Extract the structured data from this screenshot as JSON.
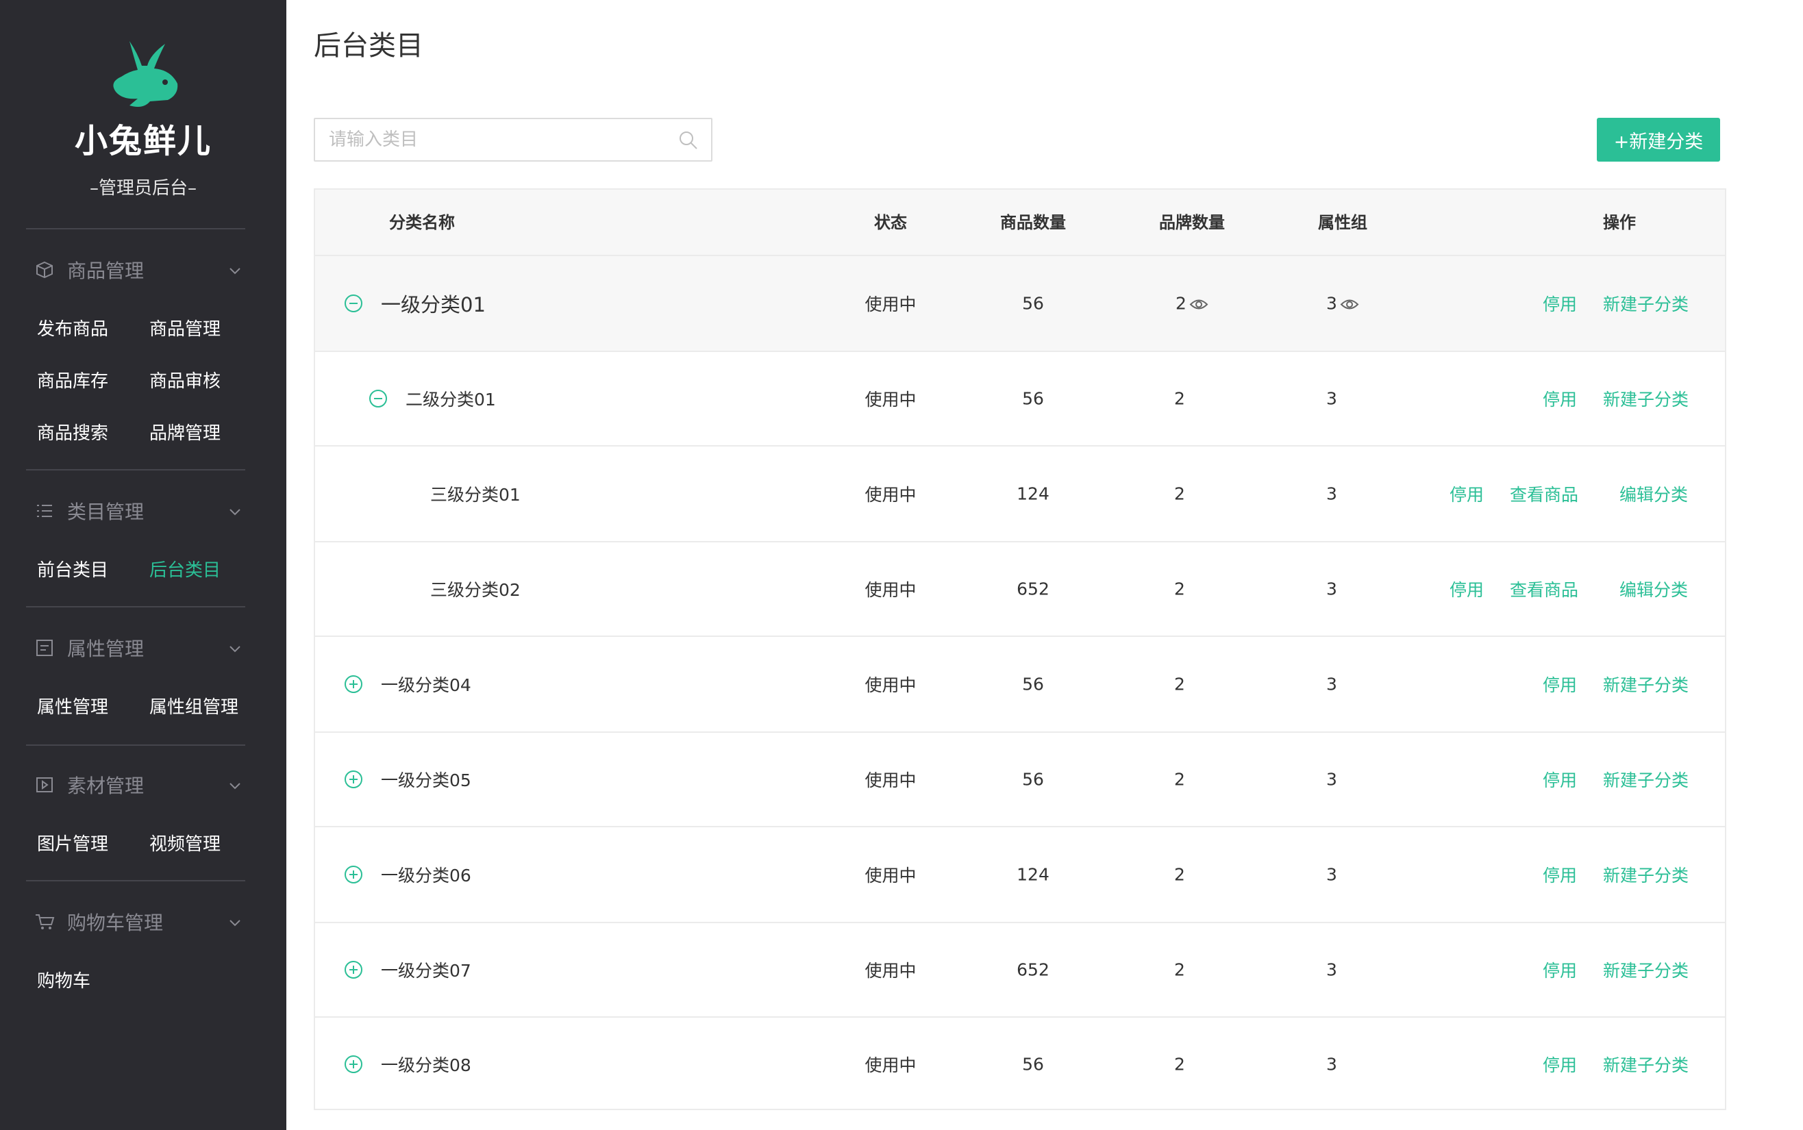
{
  "brand": {
    "name": "小兔鲜儿",
    "subtitle": "–管理员后台–",
    "accent_color": "#2bbf96",
    "sidebar_bg": "#2b2b30"
  },
  "sidebar": {
    "groups": [
      {
        "label": "商品管理",
        "icon": "box-icon",
        "items": [
          "发布商品",
          "商品管理",
          "商品库存",
          "商品审核",
          "商品搜索",
          "品牌管理"
        ]
      },
      {
        "label": "类目管理",
        "icon": "list-icon",
        "items": [
          "前台类目",
          "后台类目"
        ],
        "active": "后台类目"
      },
      {
        "label": "属性管理",
        "icon": "attribute-icon",
        "items": [
          "属性管理",
          "属性组管理"
        ]
      },
      {
        "label": "素材管理",
        "icon": "media-icon",
        "items": [
          "图片管理",
          "视频管理"
        ]
      },
      {
        "label": "购物车管理",
        "icon": "cart-icon",
        "items": [
          "购物车"
        ]
      }
    ]
  },
  "page": {
    "title": "后台类目",
    "search_placeholder": "请输入类目",
    "new_button": "+新建分类"
  },
  "table": {
    "headers": {
      "name": "分类名称",
      "status": "状态",
      "product_count": "商品数量",
      "brand_count": "品牌数量",
      "attr_group": "属性组",
      "actions": "操作"
    },
    "rows": [
      {
        "level": 1,
        "toggle": "collapse",
        "name": "一级分类01",
        "status": "使用中",
        "products": "56",
        "brands": "2",
        "attrs": "3",
        "actions": [
          "停用",
          "新建子分类"
        ]
      },
      {
        "level": 2,
        "toggle": "collapse",
        "name": "二级分类01",
        "status": "使用中",
        "products": "56",
        "brands": "2",
        "attrs": "3",
        "actions": [
          "停用",
          "新建子分类"
        ]
      },
      {
        "level": 3,
        "toggle": "none",
        "name": "三级分类01",
        "status": "使用中",
        "products": "124",
        "brands": "2",
        "attrs": "3",
        "actions": [
          "停用",
          "查看商品",
          "编辑分类"
        ]
      },
      {
        "level": 3,
        "toggle": "none",
        "name": "三级分类02",
        "status": "使用中",
        "products": "652",
        "brands": "2",
        "attrs": "3",
        "actions": [
          "停用",
          "查看商品",
          "编辑分类"
        ]
      },
      {
        "level": 1,
        "toggle": "expand",
        "name": "一级分类04",
        "status": "使用中",
        "products": "56",
        "brands": "2",
        "attrs": "3",
        "actions": [
          "停用",
          "新建子分类"
        ]
      },
      {
        "level": 1,
        "toggle": "expand",
        "name": "一级分类05",
        "status": "使用中",
        "products": "56",
        "brands": "2",
        "attrs": "3",
        "actions": [
          "停用",
          "新建子分类"
        ]
      },
      {
        "level": 1,
        "toggle": "expand",
        "name": "一级分类06",
        "status": "使用中",
        "products": "124",
        "brands": "2",
        "attrs": "3",
        "actions": [
          "停用",
          "新建子分类"
        ]
      },
      {
        "level": 1,
        "toggle": "expand",
        "name": "一级分类07",
        "status": "使用中",
        "products": "652",
        "brands": "2",
        "attrs": "3",
        "actions": [
          "停用",
          "新建子分类"
        ]
      },
      {
        "level": 1,
        "toggle": "expand",
        "name": "一级分类08",
        "status": "使用中",
        "products": "56",
        "brands": "2",
        "attrs": "3",
        "actions": [
          "停用",
          "新建子分类"
        ]
      }
    ]
  }
}
